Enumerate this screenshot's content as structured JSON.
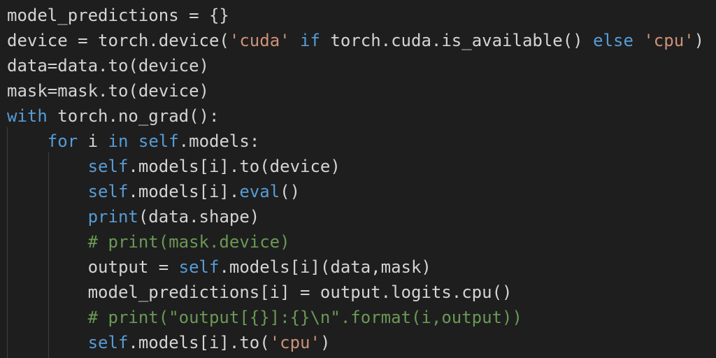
{
  "colors": {
    "background": "#1e1e1e",
    "plain": "#d4d4d4",
    "keyword": "#569cd6",
    "string": "#ce9178",
    "comment": "#6a9955"
  },
  "code": {
    "lines": [
      [
        [
          "plain",
          "model_predictions = {}"
        ]
      ],
      [
        [
          "plain",
          "device = torch.device("
        ],
        [
          "str",
          "'cuda'"
        ],
        [
          "plain",
          " "
        ],
        [
          "kw",
          "if"
        ],
        [
          "plain",
          " torch.cuda.is_available() "
        ],
        [
          "kw",
          "else"
        ],
        [
          "plain",
          " "
        ],
        [
          "str",
          "'cpu'"
        ],
        [
          "plain",
          ")"
        ]
      ],
      [
        [
          "plain",
          "data=data.to(device)"
        ]
      ],
      [
        [
          "plain",
          "mask=mask.to(device)"
        ]
      ],
      [
        [
          "kw",
          "with"
        ],
        [
          "plain",
          " torch.no_grad():"
        ]
      ],
      [
        [
          "plain",
          "    "
        ],
        [
          "kw",
          "for"
        ],
        [
          "plain",
          " i "
        ],
        [
          "kw",
          "in"
        ],
        [
          "plain",
          " "
        ],
        [
          "kw",
          "self"
        ],
        [
          "plain",
          ".models:"
        ]
      ],
      [
        [
          "plain",
          "        "
        ],
        [
          "kw",
          "self"
        ],
        [
          "plain",
          ".models[i].to(device)"
        ]
      ],
      [
        [
          "plain",
          "        "
        ],
        [
          "kw",
          "self"
        ],
        [
          "plain",
          ".models[i]."
        ],
        [
          "kw",
          "eval"
        ],
        [
          "plain",
          "()"
        ]
      ],
      [
        [
          "plain",
          "        "
        ],
        [
          "kw",
          "print"
        ],
        [
          "plain",
          "(data.shape)"
        ]
      ],
      [
        [
          "plain",
          "        "
        ],
        [
          "cm",
          "# print(mask.device)"
        ]
      ],
      [
        [
          "plain",
          "        output = "
        ],
        [
          "kw",
          "self"
        ],
        [
          "plain",
          ".models[i](data,mask)"
        ]
      ],
      [
        [
          "plain",
          "        model_predictions[i] = output.logits.cpu()"
        ]
      ],
      [
        [
          "plain",
          "        "
        ],
        [
          "cm",
          "# print(\"output[{}]:{}\\n\".format(i,output))"
        ]
      ],
      [
        [
          "plain",
          "        "
        ],
        [
          "kw",
          "self"
        ],
        [
          "plain",
          ".models[i].to("
        ],
        [
          "str",
          "'cpu'"
        ],
        [
          "plain",
          ")"
        ]
      ]
    ]
  }
}
